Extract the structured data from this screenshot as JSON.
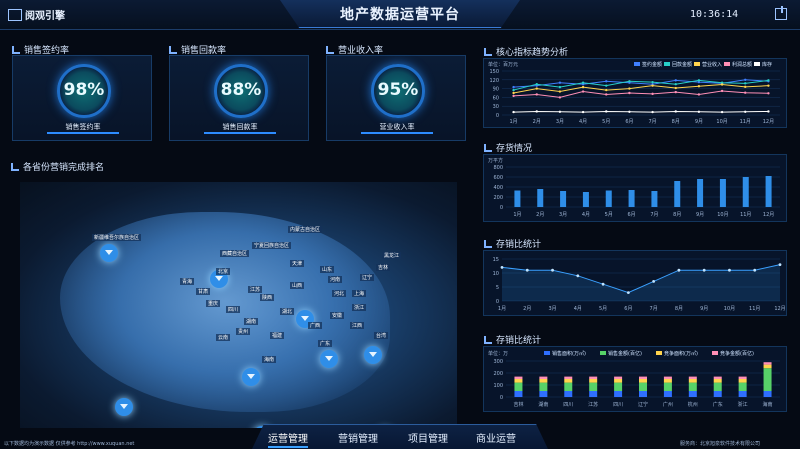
{
  "app": {
    "brand": "阅观引擎",
    "title": "地产数据运营平台",
    "clock": "10:36:14"
  },
  "kpis": [
    {
      "title": "销售签约率",
      "value": "98%",
      "label": "销售签约率"
    },
    {
      "title": "销售回款率",
      "value": "88%",
      "label": "销售回款率"
    },
    {
      "title": "营业收入率",
      "value": "95%",
      "label": "营业收入率"
    }
  ],
  "map": {
    "title": "各省份营销完成排名",
    "labels": [
      "新疆维吾尔族自治区",
      "内蒙古自治区",
      "宁夏回族自治区",
      "西藏自治区",
      "北京",
      "天津",
      "山东",
      "河南",
      "江苏",
      "上海",
      "浙江",
      "湖北",
      "湖南",
      "四川",
      "重庆",
      "贵州",
      "云南",
      "广西",
      "广东",
      "福建",
      "江西",
      "安徽",
      "陕西",
      "甘肃",
      "青海",
      "山西",
      "河北",
      "辽宁",
      "吉林",
      "黑龙江",
      "台湾",
      "海南"
    ]
  },
  "right": {
    "trend_title": "核心指标趋势分析",
    "stock_title": "存货情况",
    "sales_ratio_title": "存销比统计",
    "stock_ratio_title": "存销比统计"
  },
  "nav": {
    "items": [
      "运营管理",
      "营销管理",
      "项目管理",
      "商业运营"
    ],
    "active_index": 0
  },
  "footer": {
    "left": "以下数据均为演示数据 仅供参考 http://www.xuquan.net",
    "right": "服务商：北京旭泉软件技术有限公司"
  },
  "chart_data": [
    {
      "type": "line",
      "title": "核心指标趋势分析",
      "ylabel": "单位：百万元",
      "categories": [
        "1月",
        "2月",
        "3月",
        "4月",
        "5月",
        "6月",
        "7月",
        "8月",
        "9月",
        "10月",
        "11月",
        "12月"
      ],
      "ylim": [
        0,
        150
      ],
      "legend_position": "top-right",
      "series": [
        {
          "name": "签约金额",
          "color": "#3f7fff",
          "values": [
            95,
            100,
            110,
            105,
            115,
            110,
            105,
            118,
            112,
            108,
            120,
            115
          ]
        },
        {
          "name": "回款金额",
          "color": "#27d0c8",
          "values": [
            85,
            105,
            95,
            110,
            100,
            115,
            112,
            105,
            118,
            110,
            108,
            118
          ]
        },
        {
          "name": "营业收入",
          "color": "#ffd34d",
          "values": [
            75,
            90,
            80,
            95,
            85,
            90,
            100,
            92,
            98,
            104,
            96,
            100
          ]
        },
        {
          "name": "利润总额",
          "color": "#ff8fb6",
          "values": [
            65,
            70,
            60,
            80,
            70,
            75,
            72,
            78,
            70,
            82,
            76,
            74
          ]
        },
        {
          "name": "库存",
          "color": "#ffffff",
          "values": [
            10,
            12,
            11,
            10,
            12,
            11,
            10,
            12,
            11,
            10,
            11,
            12
          ]
        }
      ]
    },
    {
      "type": "bar",
      "title": "存货情况",
      "ylabel": "万平方",
      "categories": [
        "1月",
        "2月",
        "3月",
        "4月",
        "5月",
        "6月",
        "7月",
        "8月",
        "9月",
        "10月",
        "11月",
        "12月"
      ],
      "ylim": [
        0,
        800
      ],
      "values": [
        330,
        360,
        320,
        300,
        330,
        340,
        320,
        520,
        560,
        560,
        600,
        620
      ]
    },
    {
      "type": "line",
      "title": "存销比统计",
      "categories": [
        "1月",
        "2月",
        "3月",
        "4月",
        "5月",
        "6月",
        "7月",
        "8月",
        "9月",
        "10月",
        "11月",
        "12月"
      ],
      "ylim": [
        0,
        15
      ],
      "values": [
        12,
        11,
        11,
        9,
        6,
        3,
        7,
        11,
        11,
        11,
        11,
        13
      ]
    },
    {
      "type": "bar",
      "title": "存销比统计",
      "ylabel": "单位：万",
      "categories": [
        "吉林",
        "湖南",
        "四川",
        "江苏",
        "四川",
        "辽宁",
        "广州",
        "杭州",
        "广东",
        "浙江",
        "海南"
      ],
      "ylim": [
        0,
        300
      ],
      "legend_position": "top",
      "series": [
        {
          "name": "销售面积(万㎡)",
          "color": "#2f6fff",
          "values": [
            50,
            50,
            50,
            50,
            50,
            50,
            50,
            50,
            50,
            50,
            50
          ]
        },
        {
          "name": "销售金额(百亿)",
          "color": "#57d268",
          "values": [
            70,
            70,
            70,
            70,
            70,
            70,
            70,
            70,
            70,
            70,
            190
          ]
        },
        {
          "name": "竞争面积(万㎡)",
          "color": "#ffd34d",
          "values": [
            30,
            30,
            30,
            30,
            30,
            30,
            30,
            30,
            30,
            30,
            30
          ]
        },
        {
          "name": "竞争金额(百亿)",
          "color": "#ff8fb6",
          "values": [
            20,
            20,
            20,
            20,
            20,
            20,
            20,
            20,
            20,
            20,
            20
          ]
        }
      ]
    }
  ]
}
